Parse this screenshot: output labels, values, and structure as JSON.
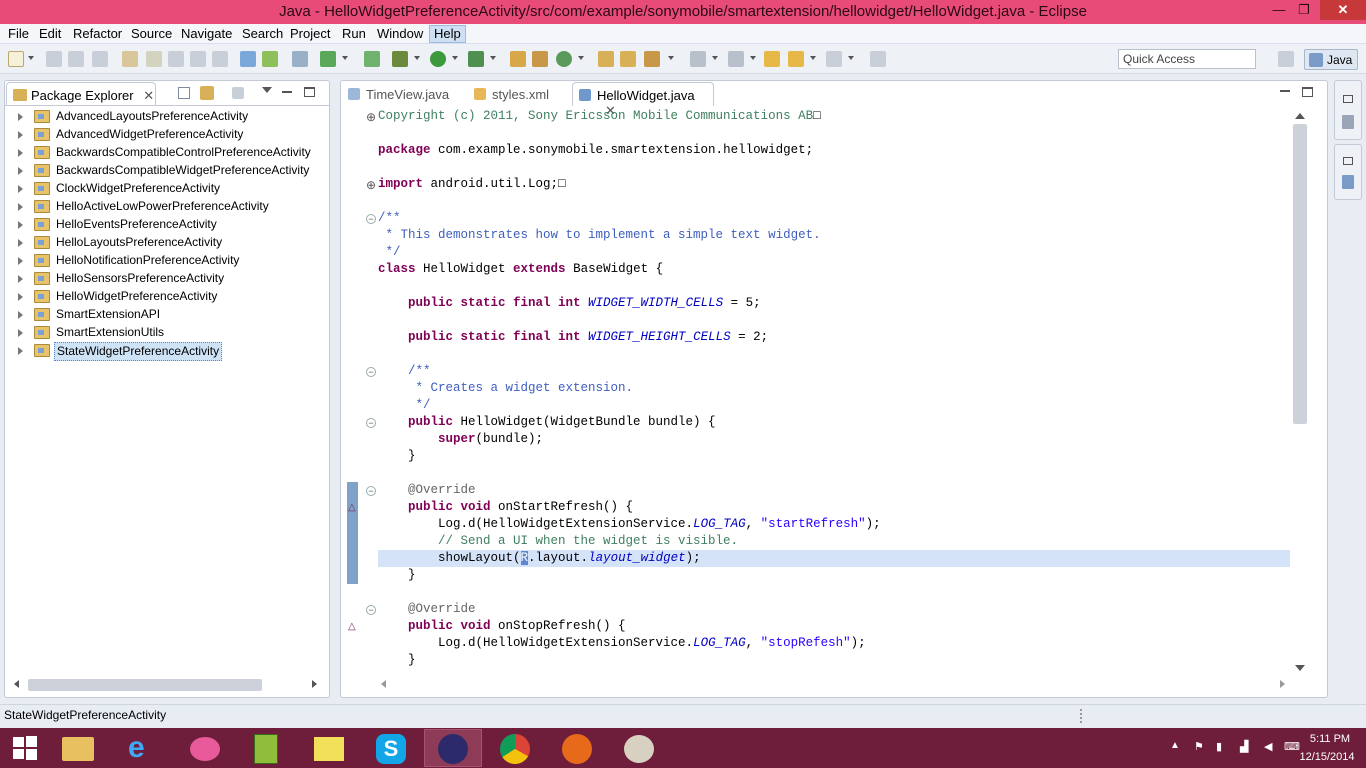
{
  "window": {
    "title": "Java - HelloWidgetPreferenceActivity/src/com/example/sonymobile/smartextension/hellowidget/HelloWidget.java - Eclipse",
    "min": "—",
    "max": "❐",
    "close": "✕"
  },
  "menu": [
    "File",
    "Edit",
    "Refactor",
    "Source",
    "Navigate",
    "Search",
    "Project",
    "Run",
    "Window",
    "Help"
  ],
  "toolbar": {
    "quick_access_placeholder": "Quick Access",
    "perspective": "Java"
  },
  "package_explorer": {
    "tab_label": "Package Explorer",
    "tab_close": "✕",
    "projects": [
      "AdvancedLayoutsPreferenceActivity",
      "AdvancedWidgetPreferenceActivity",
      "BackwardsCompatibleControlPreferenceActivity",
      "BackwardsCompatibleWidgetPreferenceActivity",
      "ClockWidgetPreferenceActivity",
      "HelloActiveLowPowerPreferenceActivity",
      "HelloEventsPreferenceActivity",
      "HelloLayoutsPreferenceActivity",
      "HelloNotificationPreferenceActivity",
      "HelloSensorsPreferenceActivity",
      "HelloWidgetPreferenceActivity",
      "SmartExtensionAPI",
      "SmartExtensionUtils",
      "StateWidgetPreferenceActivity"
    ],
    "selected_index": 13
  },
  "editor": {
    "tabs": [
      {
        "label": "TimeView.java",
        "active": false,
        "close": ""
      },
      {
        "label": "styles.xml",
        "active": false,
        "close": ""
      },
      {
        "label": "HelloWidget.java",
        "active": true,
        "close": "✕"
      }
    ],
    "code": {
      "l1": "Copyright (c) 2011, Sony Ericsson Mobile Communications AB",
      "l1_box": "□",
      "pkg_kw": "package",
      "pkg_name": " com.example.sonymobile.smartextension.hellowidget;",
      "imp_kw": "import",
      "imp_name": " android.util.Log;",
      "imp_box": "□",
      "doc1_open": "/**",
      "doc1_text": " * This demonstrates how to implement a simple text widget.",
      "doc1_close": " */",
      "cls_kw": "class",
      "cls_name": " HelloWidget ",
      "cls_ext": "extends",
      "cls_base": " BaseWidget {",
      "mod_psfi": "    public static final int ",
      "width_field": "WIDGET_WIDTH_CELLS",
      "width_val": " = 5;",
      "height_field": "WIDGET_HEIGHT_CELLS",
      "height_val": " = 2;",
      "doc2_open": "    /**",
      "doc2_text": "     * Creates a widget extension.",
      "doc2_close": "     */",
      "ctor_pub": "    public",
      "ctor_sig": " HelloWidget(WidgetBundle bundle) {",
      "super_kw": "        super",
      "super_args": "(bundle);",
      "close_brace": "    }",
      "override": "    @Override",
      "pub_void": "    public void",
      "start_sig": " onStartRefresh() {",
      "log_call": "        Log.d(HelloWidgetExtensionService.",
      "log_tag": "LOG_TAG",
      "comma": ", ",
      "start_str": "\"startRefresh\"",
      "log_end": ");",
      "comment": "        // Send a UI when the widget is visible.",
      "show_pre": "        showLayout(",
      "show_r": "R",
      "show_mid": ".layout.",
      "show_field": "layout_widget",
      "show_end": ");",
      "stop_sig": " onStopRefresh() {",
      "stop_str": "\"stopRefesh\""
    }
  },
  "status": {
    "text": "StateWidgetPreferenceActivity"
  },
  "taskbar": {
    "time": "5:11 PM",
    "date": "12/15/2014"
  }
}
